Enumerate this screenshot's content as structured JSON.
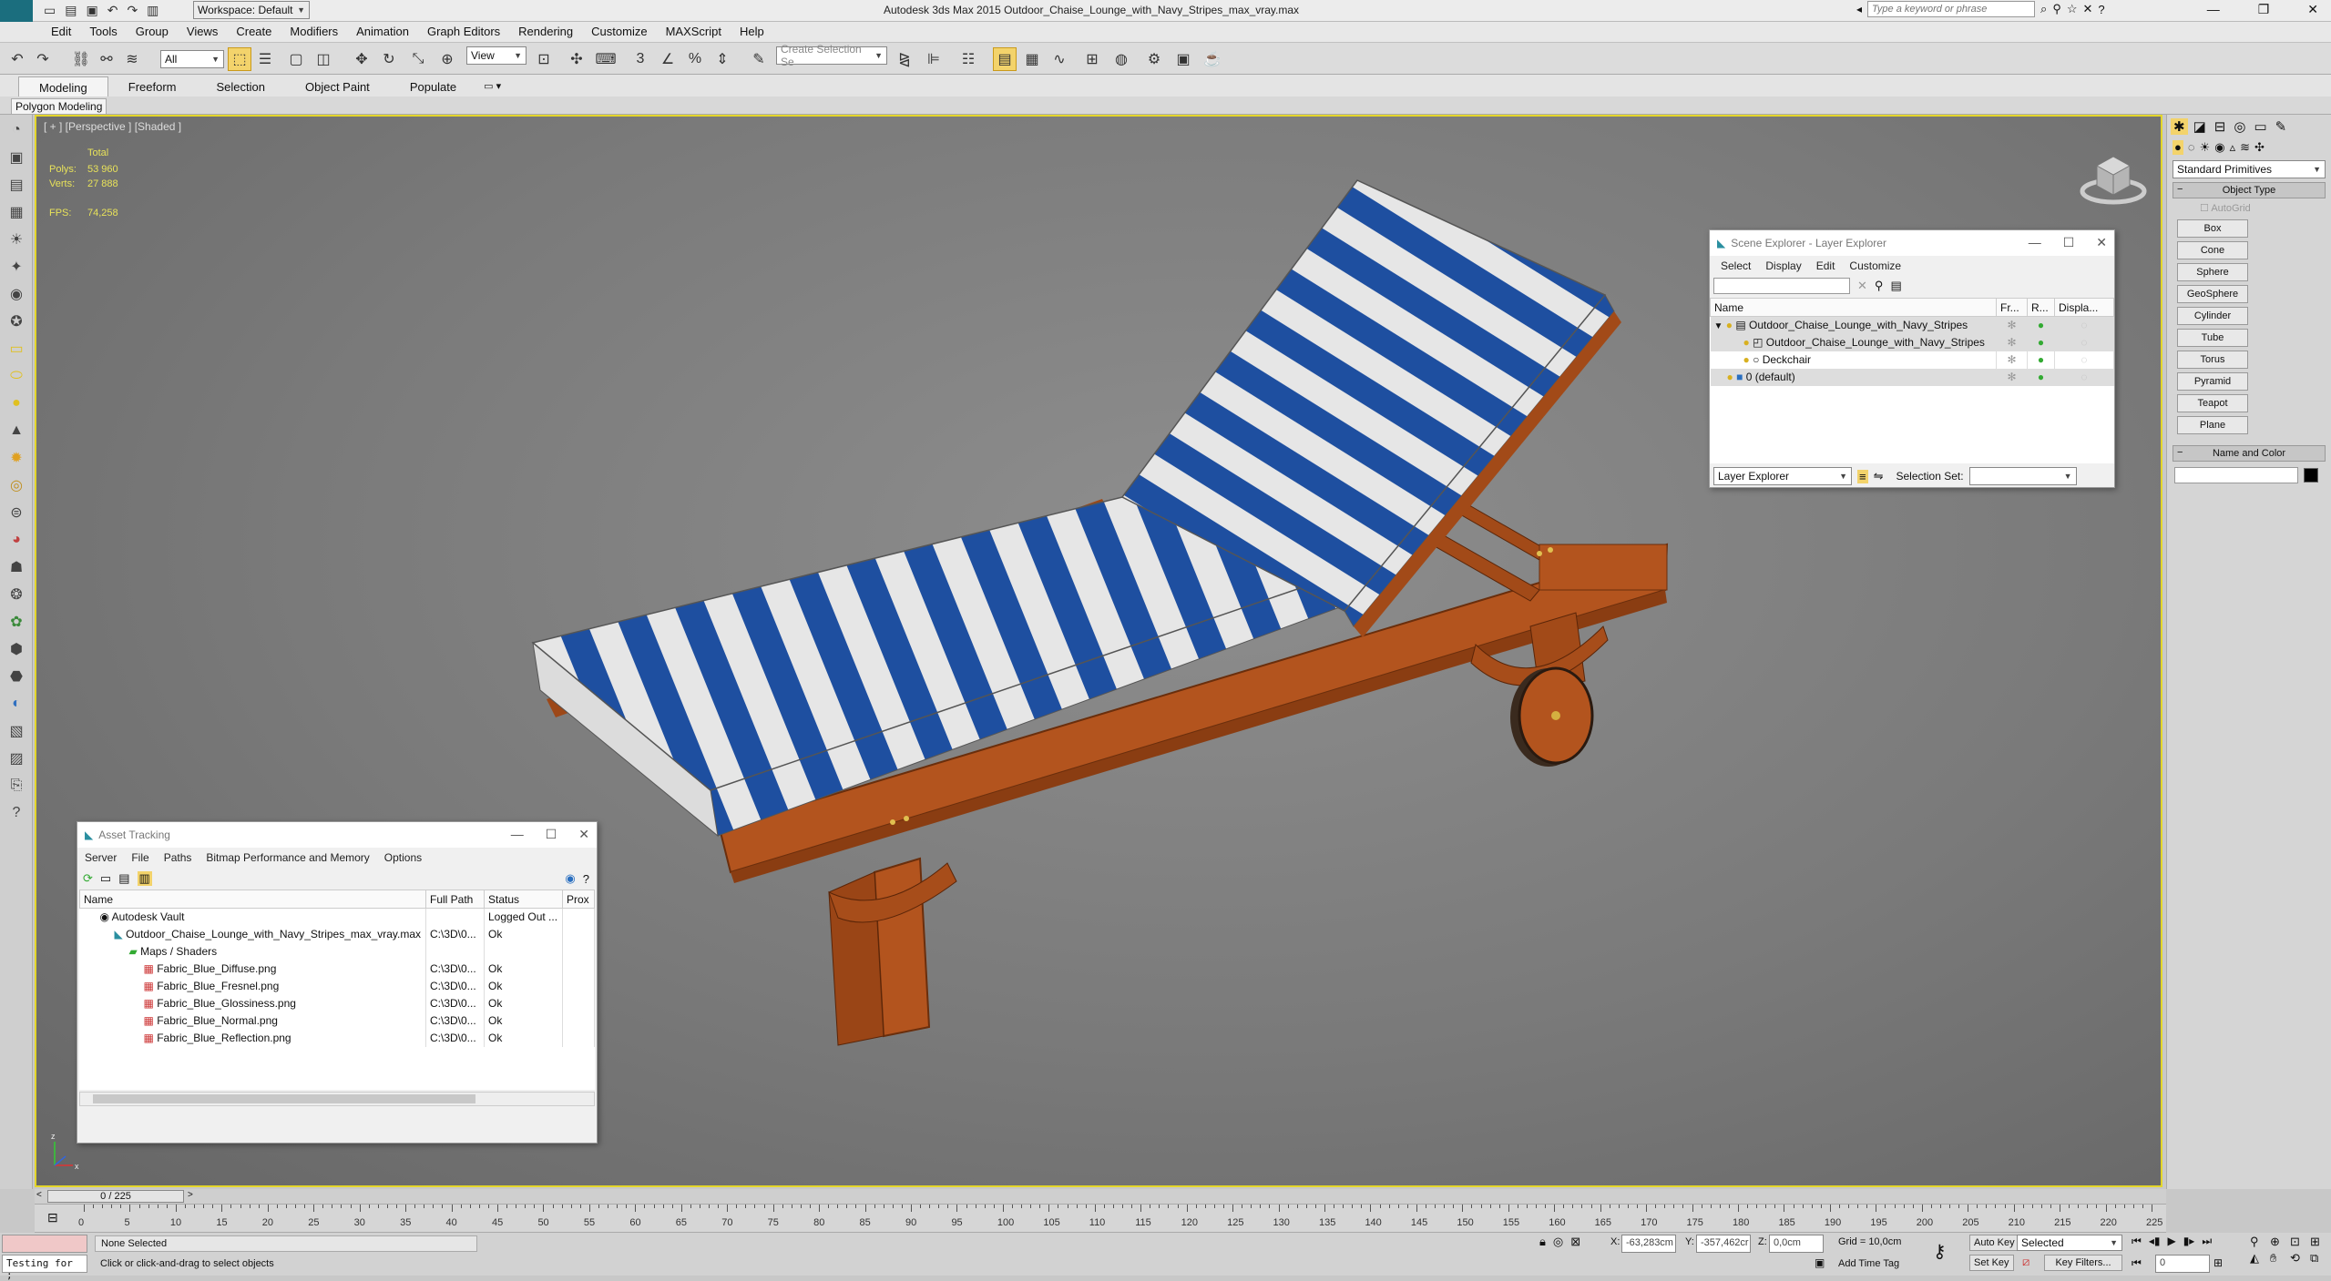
{
  "titlebar": {
    "workspace": "Workspace: Default",
    "title": "Autodesk 3ds Max  2015     Outdoor_Chaise_Lounge_with_Navy_Stripes_max_vray.max",
    "search_placeholder": "Type a keyword or phrase"
  },
  "menu": [
    "Edit",
    "Tools",
    "Group",
    "Views",
    "Create",
    "Modifiers",
    "Animation",
    "Graph Editors",
    "Rendering",
    "Customize",
    "MAXScript",
    "Help"
  ],
  "toolbar": {
    "filter": "All",
    "refcoord": "View",
    "selection_set_placeholder": "Create Selection Se"
  },
  "ribbon": {
    "tabs": [
      "Modeling",
      "Freeform",
      "Selection",
      "Object Paint",
      "Populate"
    ],
    "sub": "Polygon Modeling"
  },
  "viewport": {
    "label": "[ + ] [Perspective ] [Shaded ]",
    "stats_total": "Total",
    "polys_label": "Polys:",
    "polys": "53 960",
    "verts_label": "Verts:",
    "verts": "27 888",
    "fps_label": "FPS:",
    "fps": "74,258"
  },
  "scene_explorer": {
    "title": "Scene Explorer - Layer Explorer",
    "menu": [
      "Select",
      "Display",
      "Edit",
      "Customize"
    ],
    "columns": [
      "Name",
      "Fr...",
      "R...",
      "Displa..."
    ],
    "rows": [
      {
        "name": "Outdoor_Chaise_Lounge_with_Navy_Stripes",
        "indent": 1
      },
      {
        "name": "Outdoor_Chaise_Lounge_with_Navy_Stripes",
        "indent": 2
      },
      {
        "name": "Deckchair",
        "indent": 2
      },
      {
        "name": "0 (default)",
        "indent": 1
      }
    ],
    "footer_combo": "Layer Explorer",
    "selection_set_label": "Selection Set:"
  },
  "asset_tracking": {
    "title": "Asset Tracking",
    "menu": [
      "Server",
      "File",
      "Paths",
      "Bitmap Performance and Memory",
      "Options"
    ],
    "columns": [
      "Name",
      "Full Path",
      "Status",
      "Prox"
    ],
    "rows": [
      {
        "name": "Autodesk Vault",
        "path": "",
        "status": "Logged Out ...",
        "indent": 1
      },
      {
        "name": "Outdoor_Chaise_Lounge_with_Navy_Stripes_max_vray.max",
        "path": "C:\\3D\\0...",
        "status": "Ok",
        "indent": 2
      },
      {
        "name": "Maps / Shaders",
        "path": "",
        "status": "",
        "indent": 3
      },
      {
        "name": "Fabric_Blue_Diffuse.png",
        "path": "C:\\3D\\0...",
        "status": "Ok",
        "indent": 4
      },
      {
        "name": "Fabric_Blue_Fresnel.png",
        "path": "C:\\3D\\0...",
        "status": "Ok",
        "indent": 4
      },
      {
        "name": "Fabric_Blue_Glossiness.png",
        "path": "C:\\3D\\0...",
        "status": "Ok",
        "indent": 4
      },
      {
        "name": "Fabric_Blue_Normal.png",
        "path": "C:\\3D\\0...",
        "status": "Ok",
        "indent": 4
      },
      {
        "name": "Fabric_Blue_Reflection.png",
        "path": "C:\\3D\\0...",
        "status": "Ok",
        "indent": 4
      }
    ]
  },
  "command_panel": {
    "category": "Standard Primitives",
    "object_type_header": "Object Type",
    "autogrid": "AutoGrid",
    "buttons": [
      "Box",
      "Cone",
      "Sphere",
      "GeoSphere",
      "Cylinder",
      "Tube",
      "Torus",
      "Pyramid",
      "Teapot",
      "Plane"
    ],
    "name_color_header": "Name and Color"
  },
  "timeline": {
    "frame": "0 / 225",
    "ticks": [
      "0",
      "5",
      "10",
      "15",
      "20",
      "25",
      "30",
      "35",
      "40",
      "45",
      "50",
      "55",
      "60",
      "65",
      "70",
      "75",
      "80",
      "85",
      "90",
      "95",
      "100",
      "105",
      "110",
      "115",
      "120",
      "125",
      "130",
      "135",
      "140",
      "145",
      "150",
      "155",
      "160",
      "165",
      "170",
      "175",
      "180",
      "185",
      "190",
      "195",
      "200",
      "205",
      "210",
      "215",
      "220",
      "225"
    ]
  },
  "status": {
    "maxscript": "Testing for ;",
    "selection": "None Selected",
    "prompt": "Click or click-and-drag to select objects",
    "x_label": "X:",
    "x": "-63,283cm",
    "y_label": "Y:",
    "y": "-357,462cr",
    "z_label": "Z:",
    "z": "0,0cm",
    "grid": "Grid = 10,0cm",
    "add_time_tag": "Add Time Tag",
    "auto_key": "Auto Key",
    "set_key": "Set Key",
    "selected": "Selected",
    "key_filters": "Key Filters...",
    "current_frame": "0"
  },
  "colors": {
    "viewport_border": "#e4d62a",
    "stripe_navy": "#1e4fa0",
    "wood": "#b3541e",
    "active_tool": "#f3d36b"
  }
}
